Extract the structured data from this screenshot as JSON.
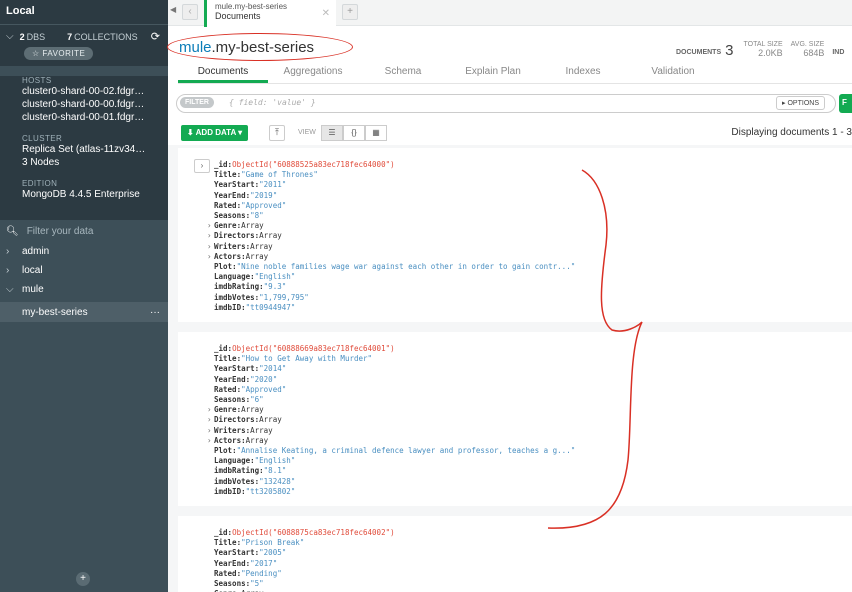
{
  "sidebar": {
    "header": "Local",
    "db_count": "2",
    "db_label": "DBS",
    "coll_count": "7",
    "coll_label": "COLLECTIONS",
    "favorite_label": "☆ FAVORITE",
    "hosts_label": "HOSTS",
    "hosts": [
      "cluster0-shard-00-02.fdgr…",
      "cluster0-shard-00-00.fdgr…",
      "cluster0-shard-00-01.fdgr…"
    ],
    "cluster_label": "CLUSTER",
    "cluster_value": "Replica Set (atlas-11zv34-…",
    "cluster_nodes": "3 Nodes",
    "edition_label": "EDITION",
    "edition_value": "MongoDB 4.4.5 Enterprise",
    "filter_placeholder": "Filter your data",
    "databases": [
      {
        "name": "admin",
        "expanded": false
      },
      {
        "name": "local",
        "expanded": false
      },
      {
        "name": "mule",
        "expanded": true
      }
    ],
    "selected_collection": "my-best-series",
    "more_icon": "···"
  },
  "tab": {
    "title": "mule.my-best-series",
    "subtitle": "Documents"
  },
  "collection": {
    "db": "mule",
    "name": ".my-best-series"
  },
  "stats": {
    "documents_label": "DOCUMENTS",
    "documents_value": "3",
    "total_size_label": "TOTAL SIZE",
    "total_size_value": "2.0KB",
    "avg_size_label": "AVG. SIZE",
    "avg_size_value": "684B",
    "indexes_label": "IND"
  },
  "subtabs": [
    "Documents",
    "Aggregations",
    "Schema",
    "Explain Plan",
    "Indexes",
    "Validation"
  ],
  "filter": {
    "label": "FILTER",
    "placeholder": "{ field: 'value' }",
    "options_label": "▸ OPTIONS",
    "find_label": "F"
  },
  "toolbar": {
    "add_data_label": "ADD DATA ▾",
    "view_label": "VIEW",
    "displaying": "Displaying documents 1 - 3"
  },
  "documents": [
    {
      "fields": [
        {
          "k": "_id",
          "t": "oid",
          "v": "ObjectId(\"60888525a83ec718fec64000\")"
        },
        {
          "k": "Title",
          "t": "s",
          "v": "\"Game of Thrones\""
        },
        {
          "k": "YearStart",
          "t": "s",
          "v": "\"2011\""
        },
        {
          "k": "YearEnd",
          "t": "s",
          "v": "\"2019\""
        },
        {
          "k": "Rated",
          "t": "s",
          "v": "\"Approved\""
        },
        {
          "k": "Seasons",
          "t": "s",
          "v": "\"8\""
        },
        {
          "k": "Genre",
          "t": "arr",
          "v": "Array"
        },
        {
          "k": "Directors",
          "t": "arr",
          "v": "Array"
        },
        {
          "k": "Writers",
          "t": "arr",
          "v": "Array"
        },
        {
          "k": "Actors",
          "t": "arr",
          "v": "Array"
        },
        {
          "k": "Plot",
          "t": "s",
          "v": "\"Nine noble families wage war against each other in order to gain contr...\""
        },
        {
          "k": "Language",
          "t": "s",
          "v": "\"English\""
        },
        {
          "k": "imdbRating",
          "t": "s",
          "v": "\"9.3\""
        },
        {
          "k": "imdbVotes",
          "t": "s",
          "v": "\"1,799,795\""
        },
        {
          "k": "imdbID",
          "t": "s",
          "v": "\"tt0944947\""
        }
      ]
    },
    {
      "fields": [
        {
          "k": "_id",
          "t": "oid",
          "v": "ObjectId(\"60888669a83ec718fec64001\")"
        },
        {
          "k": "Title",
          "t": "s",
          "v": "\"How to Get Away with Murder\""
        },
        {
          "k": "YearStart",
          "t": "s",
          "v": "\"2014\""
        },
        {
          "k": "YearEnd",
          "t": "s",
          "v": "\"2020\""
        },
        {
          "k": "Rated",
          "t": "s",
          "v": "\"Approved\""
        },
        {
          "k": "Seasons",
          "t": "s",
          "v": "\"6\""
        },
        {
          "k": "Genre",
          "t": "arr",
          "v": "Array"
        },
        {
          "k": "Directors",
          "t": "arr",
          "v": "Array"
        },
        {
          "k": "Writers",
          "t": "arr",
          "v": "Array"
        },
        {
          "k": "Actors",
          "t": "arr",
          "v": "Array"
        },
        {
          "k": "Plot",
          "t": "s",
          "v": "\"Annalise Keating, a criminal defence lawyer and professor, teaches a g...\""
        },
        {
          "k": "Language",
          "t": "s",
          "v": "\"English\""
        },
        {
          "k": "imdbRating",
          "t": "s",
          "v": "\"8.1\""
        },
        {
          "k": "imdbVotes",
          "t": "s",
          "v": "\"132428\""
        },
        {
          "k": "imdbID",
          "t": "s",
          "v": "\"tt3205802\""
        }
      ]
    },
    {
      "fields": [
        {
          "k": "_id",
          "t": "oid",
          "v": "ObjectId(\"6088875ca83ec718fec64002\")"
        },
        {
          "k": "Title",
          "t": "s",
          "v": "\"Prison Break\""
        },
        {
          "k": "YearStart",
          "t": "s",
          "v": "\"2005\""
        },
        {
          "k": "YearEnd",
          "t": "s",
          "v": "\"2017\""
        },
        {
          "k": "Rated",
          "t": "s",
          "v": "\"Pending\""
        },
        {
          "k": "Seasons",
          "t": "s",
          "v": "\"5\""
        },
        {
          "k": "Genre",
          "t": "arr",
          "v": "Array"
        }
      ]
    }
  ],
  "colors": {
    "accent": "#13aa52",
    "sidebar_bg": "#3d4f58",
    "annotation": "#d93025"
  }
}
